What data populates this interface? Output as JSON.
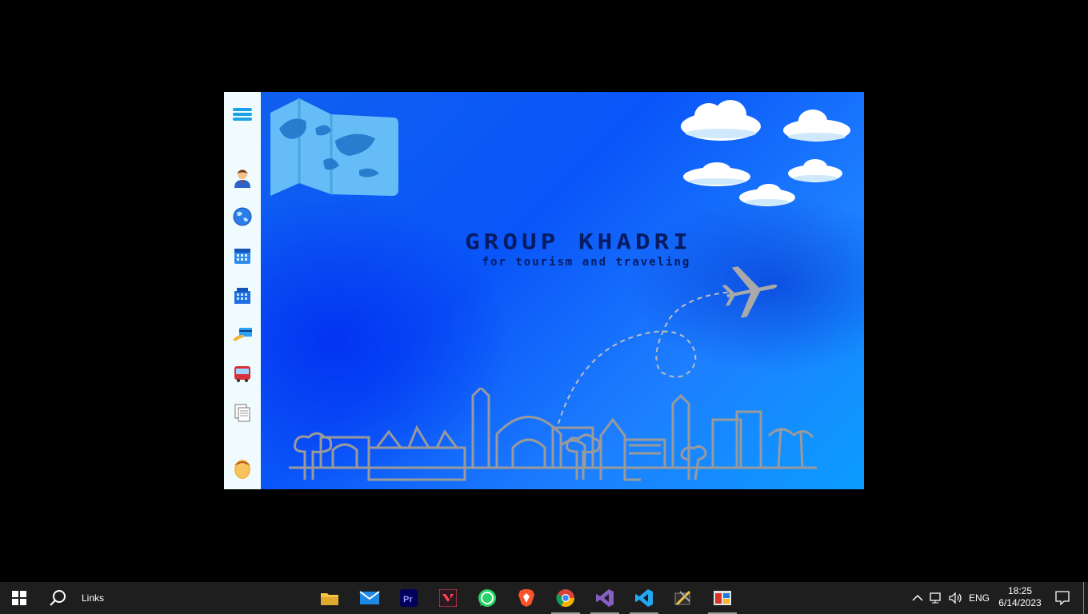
{
  "app": {
    "title": "GROUP KHADRI",
    "subtitle": "for tourism and traveling"
  },
  "sidebar": {
    "items": [
      {
        "name": "menu",
        "icon": "hamburger-menu-icon"
      },
      {
        "name": "users",
        "icon": "user-icon"
      },
      {
        "name": "destinations",
        "icon": "globe-icon"
      },
      {
        "name": "calendar",
        "icon": "calendar-icon"
      },
      {
        "name": "hotels",
        "icon": "building-icon"
      },
      {
        "name": "payments",
        "icon": "credit-card-icon"
      },
      {
        "name": "transport",
        "icon": "bus-icon"
      },
      {
        "name": "reports",
        "icon": "documents-icon"
      },
      {
        "name": "profile",
        "icon": "avatar-icon"
      }
    ]
  },
  "taskbar": {
    "search_label": "Links",
    "apps": [
      "file-explorer-icon",
      "mail-icon",
      "premiere-pro-icon",
      "valorant-icon",
      "whatsapp-icon",
      "brave-icon",
      "chrome-icon",
      "visual-studio-icon",
      "vscode-icon",
      "tool-icon",
      "app-icon"
    ],
    "language": "ENG",
    "time": "18:25",
    "date": "6/14/2023"
  },
  "colors": {
    "accent_blue": "#0a55f8",
    "title_navy": "#061b63",
    "sidebar_bg": "#f0fbfd",
    "taskbar_bg": "#1e1e1e"
  }
}
